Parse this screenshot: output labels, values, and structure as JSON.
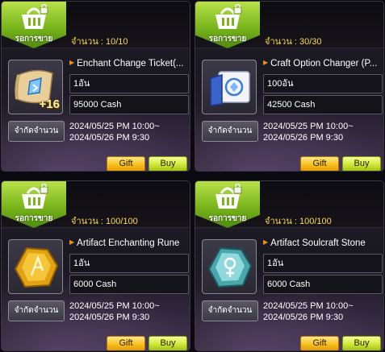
{
  "colors": {
    "badge_green": "#8ec62b",
    "quantity_yellow": "#ffd84a",
    "gift_gold": "#f7c120",
    "buy_lime": "#cfe83a"
  },
  "items": [
    {
      "badge_label": "รอการขาย",
      "quantity": "จำนวน :  10/10",
      "icon": "scroll-ticket-icon",
      "overlay": "+16",
      "name": "Enchant Change Ticket(...",
      "unit": "1อัน",
      "price": "95000 Cash",
      "limit_label": "จำกัดจำนวน",
      "date_start": "2024/05/25 PM 10:00~",
      "date_end": "2024/05/26 PM 9:30",
      "gift_label": "Gift",
      "buy_label": "Buy"
    },
    {
      "badge_label": "รอการขาย",
      "quantity": "จำนวน :  30/30",
      "icon": "blue-scroll-icon",
      "overlay": "",
      "name": "Craft Option Changer (P...",
      "unit": "100อัน",
      "price": "42500 Cash",
      "limit_label": "จำกัดจำนวน",
      "date_start": "2024/05/25 PM 10:00~",
      "date_end": "2024/05/26 PM 9:30",
      "gift_label": "Gift",
      "buy_label": "Buy"
    },
    {
      "badge_label": "รอการขาย",
      "quantity": "จำนวน :  100/100",
      "icon": "gold-rune-icon",
      "overlay": "",
      "name": "Artifact Enchanting Rune",
      "unit": "1อัน",
      "price": "6000 Cash",
      "limit_label": "จำกัดจำนวน",
      "date_start": "2024/05/25 PM 10:00~",
      "date_end": "2024/05/26 PM 9:30",
      "gift_label": "Gift",
      "buy_label": "Buy"
    },
    {
      "badge_label": "รอการขาย",
      "quantity": "จำนวน :  100/100",
      "icon": "teal-rune-icon",
      "overlay": "",
      "name": "Artifact Soulcraft Stone",
      "unit": "1อัน",
      "price": "6000 Cash",
      "limit_label": "จำกัดจำนวน",
      "date_start": "2024/05/25 PM 10:00~",
      "date_end": "2024/05/26 PM 9:30",
      "gift_label": "Gift",
      "buy_label": "Buy"
    }
  ]
}
